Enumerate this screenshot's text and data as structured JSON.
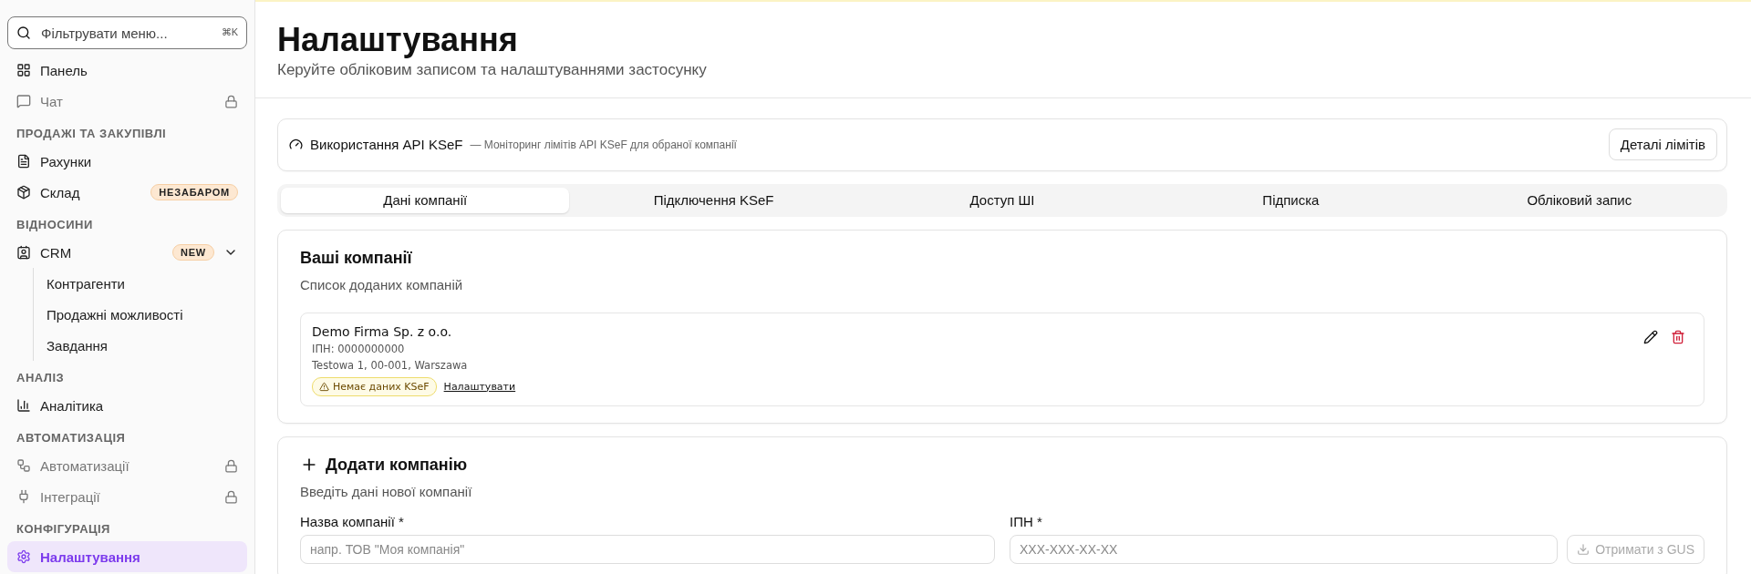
{
  "sidebar": {
    "search": {
      "placeholder": "Фільтрувати меню...",
      "shortcut": "⌘K"
    },
    "sections": [
      {
        "items": [
          {
            "label": "Панель",
            "selected": false,
            "locked": false
          },
          {
            "label": "Чат",
            "selected": false,
            "locked": true
          }
        ]
      },
      {
        "title": "ПРОДАЖІ ТА ЗАКУПІВЛІ",
        "items": [
          {
            "label": "Рахунки",
            "selected": false,
            "locked": false
          },
          {
            "label": "Склад",
            "selected": false,
            "locked": false,
            "badge": "НЕЗАБАРОМ"
          }
        ]
      },
      {
        "title": "ВІДНОСИНИ",
        "items": [
          {
            "label": "CRM",
            "selected": false,
            "locked": false,
            "badge": "NEW",
            "expanded": true,
            "children": [
              {
                "label": "Контрагенти",
                "selected": false
              },
              {
                "label": "Продажні можливості",
                "selected": false
              },
              {
                "label": "Завдання",
                "selected": false
              }
            ]
          }
        ]
      },
      {
        "title": "АНАЛІЗ",
        "items": [
          {
            "label": "Аналітика",
            "selected": false,
            "locked": false
          }
        ]
      },
      {
        "title": "АВТОМАТИЗАЦІЯ",
        "items": [
          {
            "label": "Автоматизації",
            "selected": false,
            "locked": true
          },
          {
            "label": "Інтеграції",
            "selected": false,
            "locked": true
          }
        ]
      },
      {
        "title": "КОНФІГУРАЦІЯ",
        "items": [
          {
            "label": "Налаштування",
            "selected": true,
            "locked": false
          }
        ]
      }
    ]
  },
  "header": {
    "title": "Налаштування",
    "subtitle": "Керуйте обліковим записом та налаштуваннями застосунку"
  },
  "api_usage": {
    "title": "Використання API KSeF",
    "description": "— Моніторинг лімітів API KSeF для обраної компанії",
    "button": "Деталі лімітів"
  },
  "tabs": [
    {
      "label": "Дані компанії",
      "selected": true
    },
    {
      "label": "Підключення KSeF",
      "selected": false
    },
    {
      "label": "Доступ ШІ",
      "selected": false
    },
    {
      "label": "Підписка",
      "selected": false
    },
    {
      "label": "Обліковий запис",
      "selected": false
    }
  ],
  "companies": {
    "title": "Ваші компанії",
    "subtitle": "Список доданих компаній",
    "items": [
      {
        "name": "Demo Firma Sp. z o.o.",
        "tax_id": "ІПН: 0000000000",
        "address": "Testowa 1, 00-001, Warszawa",
        "warning": "Немає даних KSeF",
        "link": "Налаштувати"
      }
    ]
  },
  "add_company": {
    "title": "Додати компанію",
    "subtitle": "Введіть дані нової компанії",
    "fields": [
      {
        "label": "Назва компанії *",
        "placeholder": "напр. ТОВ \"Моя компанія\""
      },
      {
        "label": "ІПН *",
        "placeholder": "XXX-XXX-XX-XX",
        "button": {
          "label": "Отримати з GUS",
          "disabled": true
        }
      }
    ]
  }
}
